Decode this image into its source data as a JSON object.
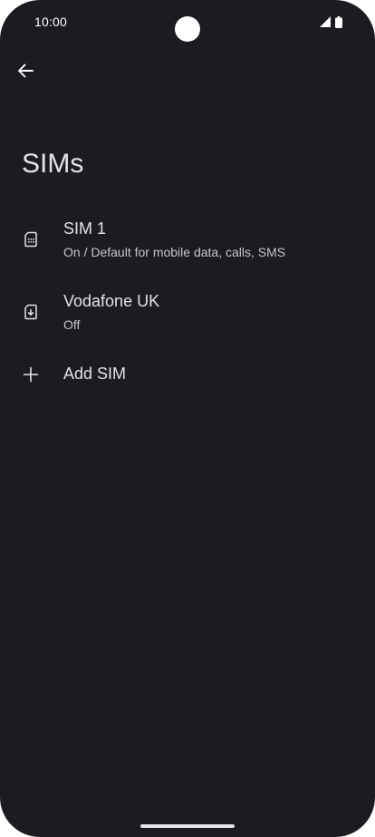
{
  "status_bar": {
    "time": "10:00",
    "icons": [
      "signal-icon",
      "battery-icon"
    ]
  },
  "toolbar": {
    "back_icon": "arrow-back-icon"
  },
  "page": {
    "title": "SIMs"
  },
  "sims": [
    {
      "icon": "sim-card-icon",
      "title": "SIM 1",
      "subtitle": "On / Default for mobile data, calls, SMS"
    },
    {
      "icon": "esim-download-icon",
      "title": "Vodafone UK",
      "subtitle": "Off"
    }
  ],
  "add_sim": {
    "icon": "plus-icon",
    "label": "Add SIM"
  },
  "colors": {
    "background": "#1c1b21",
    "text_primary": "#e6e1e9",
    "text_secondary": "#c9c4cf"
  }
}
